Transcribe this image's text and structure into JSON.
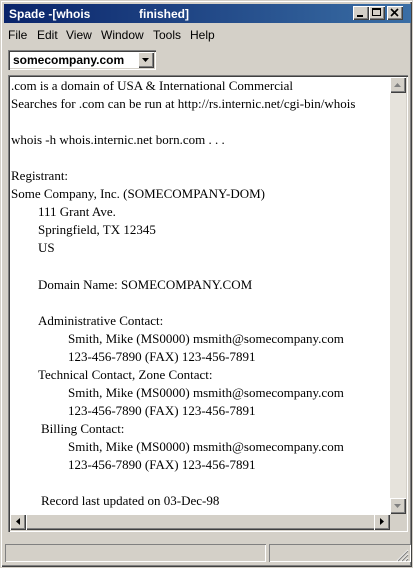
{
  "window": {
    "title": "Spade -[whois",
    "status": "finished]"
  },
  "menu": [
    "File",
    "Edit",
    "View",
    "Window",
    "Tools",
    "Help"
  ],
  "query": {
    "value": "somecompany.com"
  },
  "output": {
    "lines": [
      ".com is a domain of USA & International Commercial",
      "Searches for .com can be run at http://rs.internic.net/cgi-bin/whois",
      "",
      "whois -h whois.internic.net born.com . . .",
      "",
      "Registrant:",
      "Some Company, Inc. (SOMECOMPANY-DOM)",
      "111 Grant Ave.",
      "Springfield, TX 12345",
      "US",
      "",
      "Domain Name: SOMECOMPANY.COM",
      "",
      "Administrative Contact:",
      "Smith, Mike (MS0000) msmith@somecompany.com",
      "123-456-7890 (FAX) 123-456-7891",
      "Technical Contact, Zone Contact:",
      "Smith, Mike (MS0000) msmith@somecompany.com",
      "123-456-7890 (FAX) 123-456-7891",
      "Billing Contact:",
      "Smith, Mike (MS0000) msmith@somecompany.com",
      "123-456-7890 (FAX) 123-456-7891",
      "",
      "Record last updated on 03-Dec-98"
    ]
  },
  "icons": {
    "minimize": "minimize-icon",
    "maximize": "maximize-icon",
    "close": "close-icon",
    "combo": "chevron-down-icon"
  }
}
